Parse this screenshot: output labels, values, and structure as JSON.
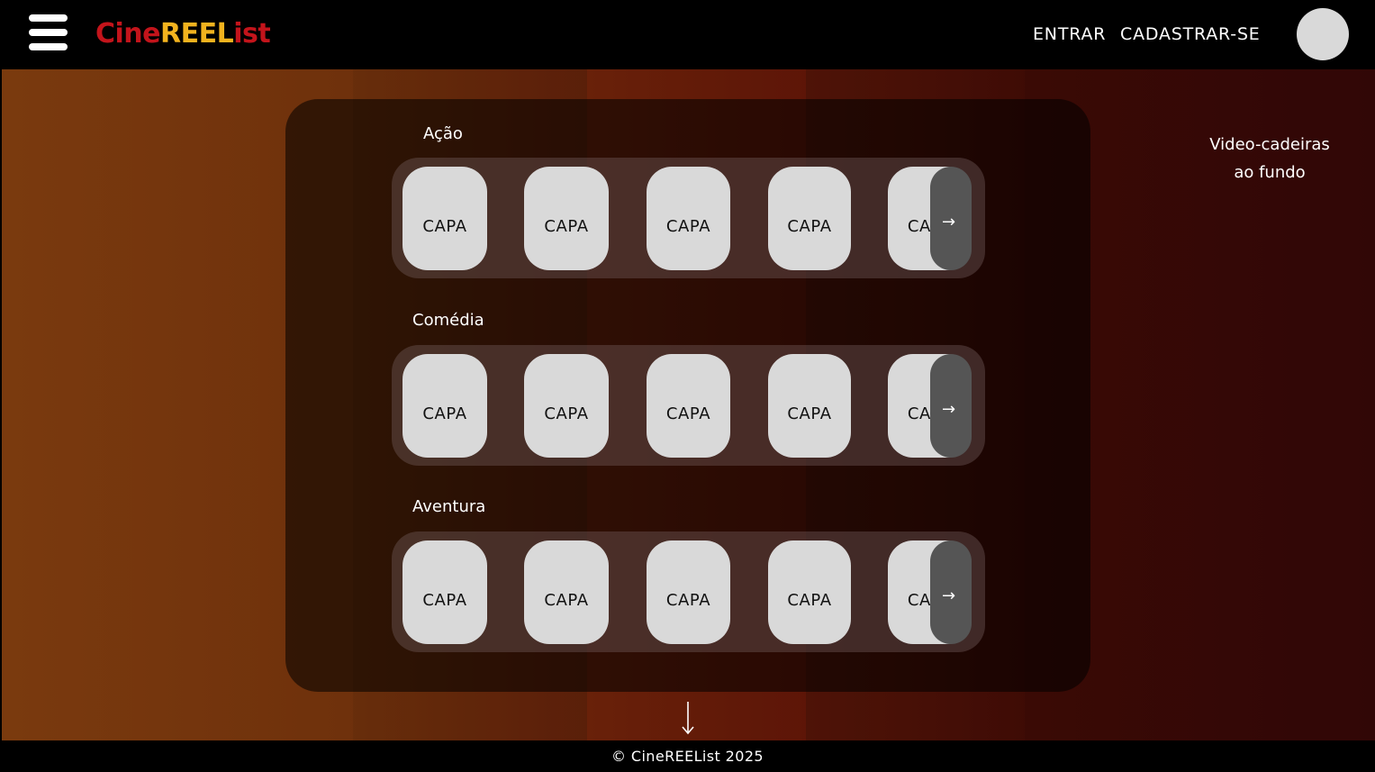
{
  "header": {
    "logo": {
      "part1": "Cine",
      "part2": "REEL",
      "part3": "ist"
    },
    "nav": {
      "login": "ENTRAR",
      "signup": "CADASTRAR-SE"
    }
  },
  "background": {
    "note_line1": "Video-cadeiras",
    "note_line2": "ao fundo"
  },
  "sections": [
    {
      "title": "Ação",
      "cards": [
        "CAPA",
        "CAPA",
        "CAPA",
        "CAPA",
        "CAPA"
      ],
      "next_icon": "→"
    },
    {
      "title": "Comédia",
      "cards": [
        "CAPA",
        "CAPA",
        "CAPA",
        "CAPA",
        "CAPA"
      ],
      "next_icon": "→"
    },
    {
      "title": "Aventura",
      "cards": [
        "CAPA",
        "CAPA",
        "CAPA",
        "CAPA",
        "CAPA"
      ],
      "next_icon": "→"
    }
  ],
  "icons": {
    "menu": "hamburger-menu-icon",
    "user": "user-avatar-icon",
    "scroll": "arrow-down-icon",
    "next": "arrow-right-icon"
  },
  "colors": {
    "logo_red": "#c3141b",
    "logo_yellow": "#f2b31e",
    "card": "#d9d9d9",
    "arrow_button": "#555555"
  },
  "footer": {
    "text": "© CineREEList 2025"
  }
}
